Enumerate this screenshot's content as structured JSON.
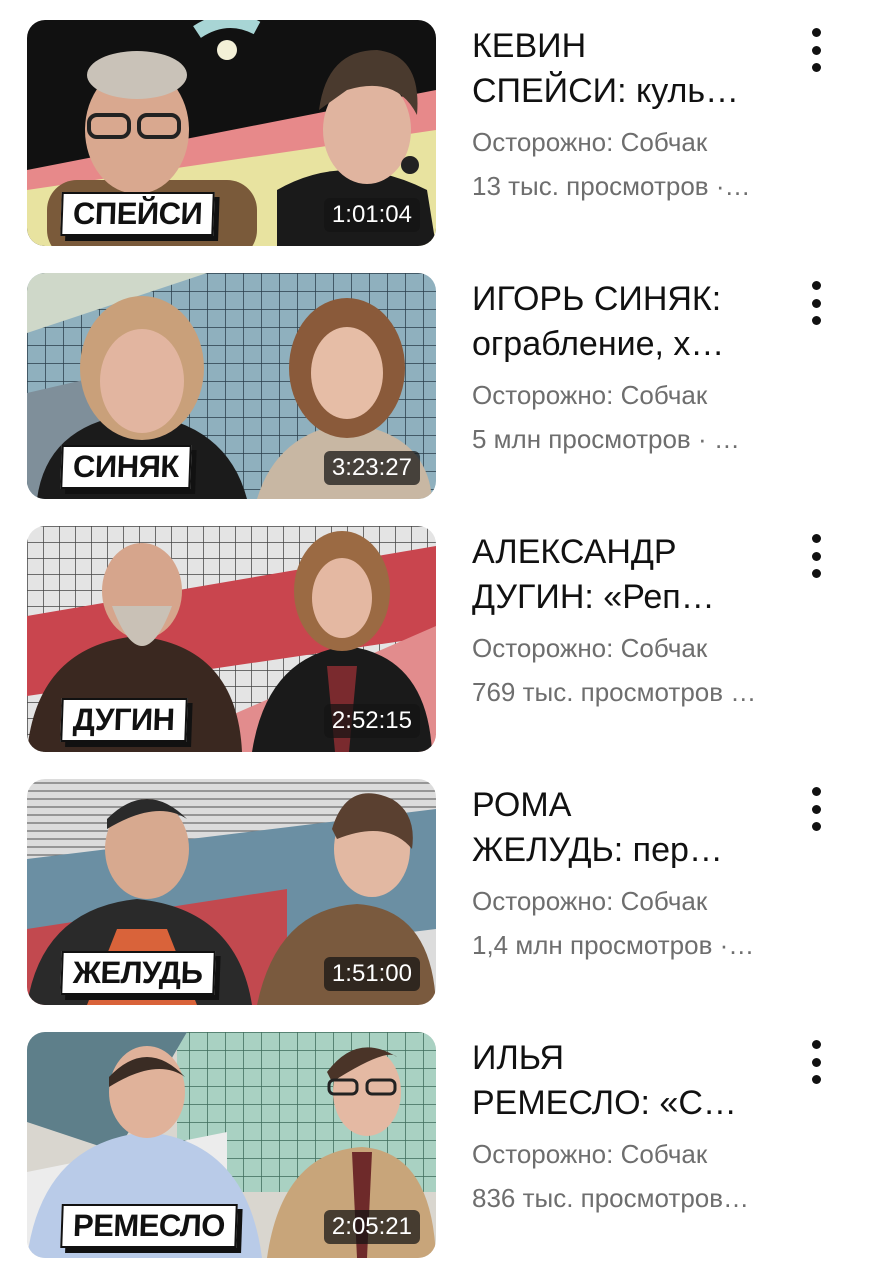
{
  "videos": [
    {
      "title_line1": "КЕВИН",
      "title_line2": "СПЕЙСИ: куль…",
      "channel": "Осторожно: Собчак",
      "views": "13 тыс. просмотров ·…",
      "duration": "1:01:04",
      "thumb_label": "СПЕЙСИ",
      "theme": "spacey"
    },
    {
      "title_line1": "ИГОРЬ СИНЯК:",
      "title_line2": "ограбление, х…",
      "channel": "Осторожно: Собчак",
      "views": "5 млн просмотров · …",
      "duration": "3:23:27",
      "thumb_label": "СИНЯК",
      "theme": "sinyak"
    },
    {
      "title_line1": "АЛЕКСАНДР",
      "title_line2": "ДУГИН: «Реп…",
      "channel": "Осторожно: Собчак",
      "views": "769 тыс. просмотров …",
      "duration": "2:52:15",
      "thumb_label": "ДУГИН",
      "theme": "dugin"
    },
    {
      "title_line1": "РОМА",
      "title_line2": "ЖЕЛУДЬ: пер…",
      "channel": "Осторожно: Собчак",
      "views": "1,4 млн просмотров ·…",
      "duration": "1:51:00",
      "thumb_label": "ЖЕЛУДЬ",
      "theme": "zhelud"
    },
    {
      "title_line1": "ИЛЬЯ",
      "title_line2": "РЕМЕСЛО: «С…",
      "channel": "Осторожно: Собчак",
      "views": "836 тыс. просмотров…",
      "duration": "2:05:21",
      "thumb_label": "РЕМЕСЛО",
      "theme": "remeslo"
    }
  ],
  "icons": {
    "menu": "more-vertical-icon"
  },
  "colors": {
    "title": "#111111",
    "meta": "#6e6e6e",
    "duration_bg": "#141414"
  }
}
